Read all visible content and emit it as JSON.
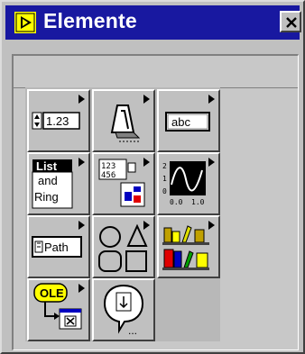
{
  "window": {
    "title": "Elemente",
    "close_glyph": "✕"
  },
  "palette": {
    "tiles": [
      {
        "name": "numeric",
        "label": "1.23"
      },
      {
        "name": "boolean",
        "label": ""
      },
      {
        "name": "string",
        "label": "abc"
      },
      {
        "name": "list-and-ring",
        "label_line1": "List",
        "label_line2": "and",
        "label_line3": "Ring"
      },
      {
        "name": "array-cluster",
        "label": ""
      },
      {
        "name": "graph",
        "label": ""
      },
      {
        "name": "path",
        "label": "Path"
      },
      {
        "name": "decorations",
        "label": ""
      },
      {
        "name": "controls-library",
        "label": ""
      },
      {
        "name": "activex-ole",
        "label": "OLE"
      },
      {
        "name": "select-control",
        "label": ""
      }
    ]
  },
  "colors": {
    "titlebar": "#1818a0",
    "face": "#c0c0c0",
    "panel": "#c8c8c8",
    "accent_yellow": "#ffff00",
    "accent_red": "#e00000",
    "accent_blue": "#0000c0"
  },
  "icons": [
    "app-icon",
    "close-icon",
    "numeric-icon",
    "boolean-icon",
    "string-icon",
    "list-ring-icon",
    "array-cluster-icon",
    "graph-icon",
    "path-icon",
    "decorations-icon",
    "controls-library-icon",
    "ole-icon",
    "select-control-icon"
  ]
}
